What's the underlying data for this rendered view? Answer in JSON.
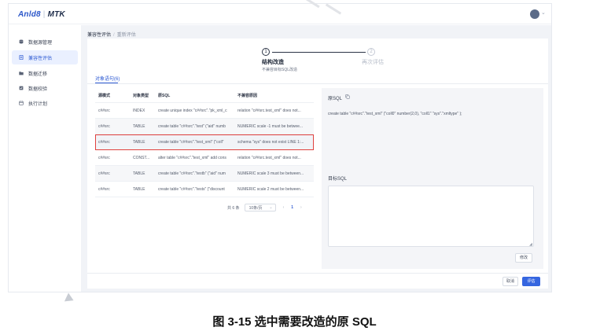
{
  "app": {
    "logo_main": "Anld8",
    "logo_product": "MTK"
  },
  "sidebar": {
    "items": [
      {
        "label": "数据源管理",
        "icon": "database-icon"
      },
      {
        "label": "兼容性评估",
        "icon": "document-icon",
        "active": true
      },
      {
        "label": "数据迁移",
        "icon": "folder-icon"
      },
      {
        "label": "数据校验",
        "icon": "check-file-icon"
      },
      {
        "label": "执行计划",
        "icon": "calendar-icon"
      }
    ]
  },
  "breadcrumb": {
    "parent": "兼容性评估",
    "separator": "/",
    "current": "重新评估"
  },
  "steps": [
    {
      "number": "1",
      "title": "结构改造",
      "description": "不兼容目标SQL改造"
    },
    {
      "number": "2",
      "title": "再次评估",
      "description": ""
    }
  ],
  "tab": {
    "label": "对象语句(6)"
  },
  "table": {
    "columns": [
      "源模式",
      "对象类型",
      "原SQL",
      "不兼容原因"
    ],
    "rows": [
      [
        "c##src",
        "INDEX",
        "create unique index \"c##src\".\"pk_xml_c",
        "relation \"c##src.test_xml\" does not..."
      ],
      [
        "c##src",
        "TABLE",
        "create table \"c##src\".\"test\" (\"aid\" numb",
        "NUMERIC scale -1 must be betwee..."
      ],
      [
        "c##src",
        "TABLE",
        "create table \"c##src\".\"test_xml\" (\"coll\"",
        "schema \"sys\" does not exist LINE 1:..."
      ],
      [
        "c##src",
        "CONST...",
        "alter table \"c##src\".\"test_xml\" add cons",
        "relation \"c##src.test_xml\" does not..."
      ],
      [
        "c##src",
        "TABLE",
        "create table \"c##src\".\"testb\" (\"aid\" num",
        "NUMERIC scale 3 must be between..."
      ],
      [
        "c##src",
        "TABLE",
        "create table \"c##src\".\"tests\" (\"discount",
        "NUMERIC scale 2 must be between..."
      ]
    ],
    "selected_row": 2
  },
  "pagination": {
    "total": "共 6 条",
    "page_size": "10条/页",
    "prev": "‹",
    "page": "1",
    "next": "›"
  },
  "detail": {
    "source_label": "原SQL",
    "source_sql": "create table \"c##src\".\"test_xml\" (\"coll0\" number(2,0), \"coll1\" \"sys\".\"xmltype\" );",
    "target_label": "目标SQL",
    "target_value": "",
    "modify_button": "修改"
  },
  "footer": {
    "cancel": "取消",
    "evaluate": "评估"
  },
  "caption": "图 3-15  选中需要改造的原 SQL",
  "colors": {
    "accent": "#3566e0",
    "selected_outline": "#e0413e"
  }
}
